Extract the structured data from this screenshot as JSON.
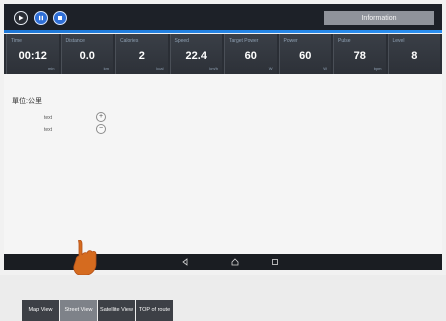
{
  "topbar": {
    "info_label": "Information"
  },
  "stats": [
    {
      "label": "Time",
      "value": "00:12",
      "unit": "min"
    },
    {
      "label": "Distance",
      "value": "0.0",
      "unit": "km"
    },
    {
      "label": "Calories",
      "value": "2",
      "unit": "kcal"
    },
    {
      "label": "Speed",
      "value": "22.4",
      "unit": "km/h"
    },
    {
      "label": "Target Power",
      "value": "60",
      "unit": "W"
    },
    {
      "label": "Power",
      "value": "60",
      "unit": "W"
    },
    {
      "label": "Pulse",
      "value": "78",
      "unit": "bpm"
    },
    {
      "label": "Level",
      "value": "8",
      "unit": ""
    }
  ],
  "map": {
    "title": "單位:公里",
    "rows": [
      {
        "label": "text"
      },
      {
        "label": "text"
      }
    ]
  },
  "view_switch": {
    "map_view": "Map View",
    "street_view": "Street View",
    "satellite_view": "Satellite View",
    "top_of_route": "TOP of route"
  },
  "icons": {
    "play": "play-icon",
    "pause": "pause-icon",
    "stop": "stop-icon",
    "back": "back-icon",
    "home": "home-icon",
    "recent": "recent-icon"
  }
}
